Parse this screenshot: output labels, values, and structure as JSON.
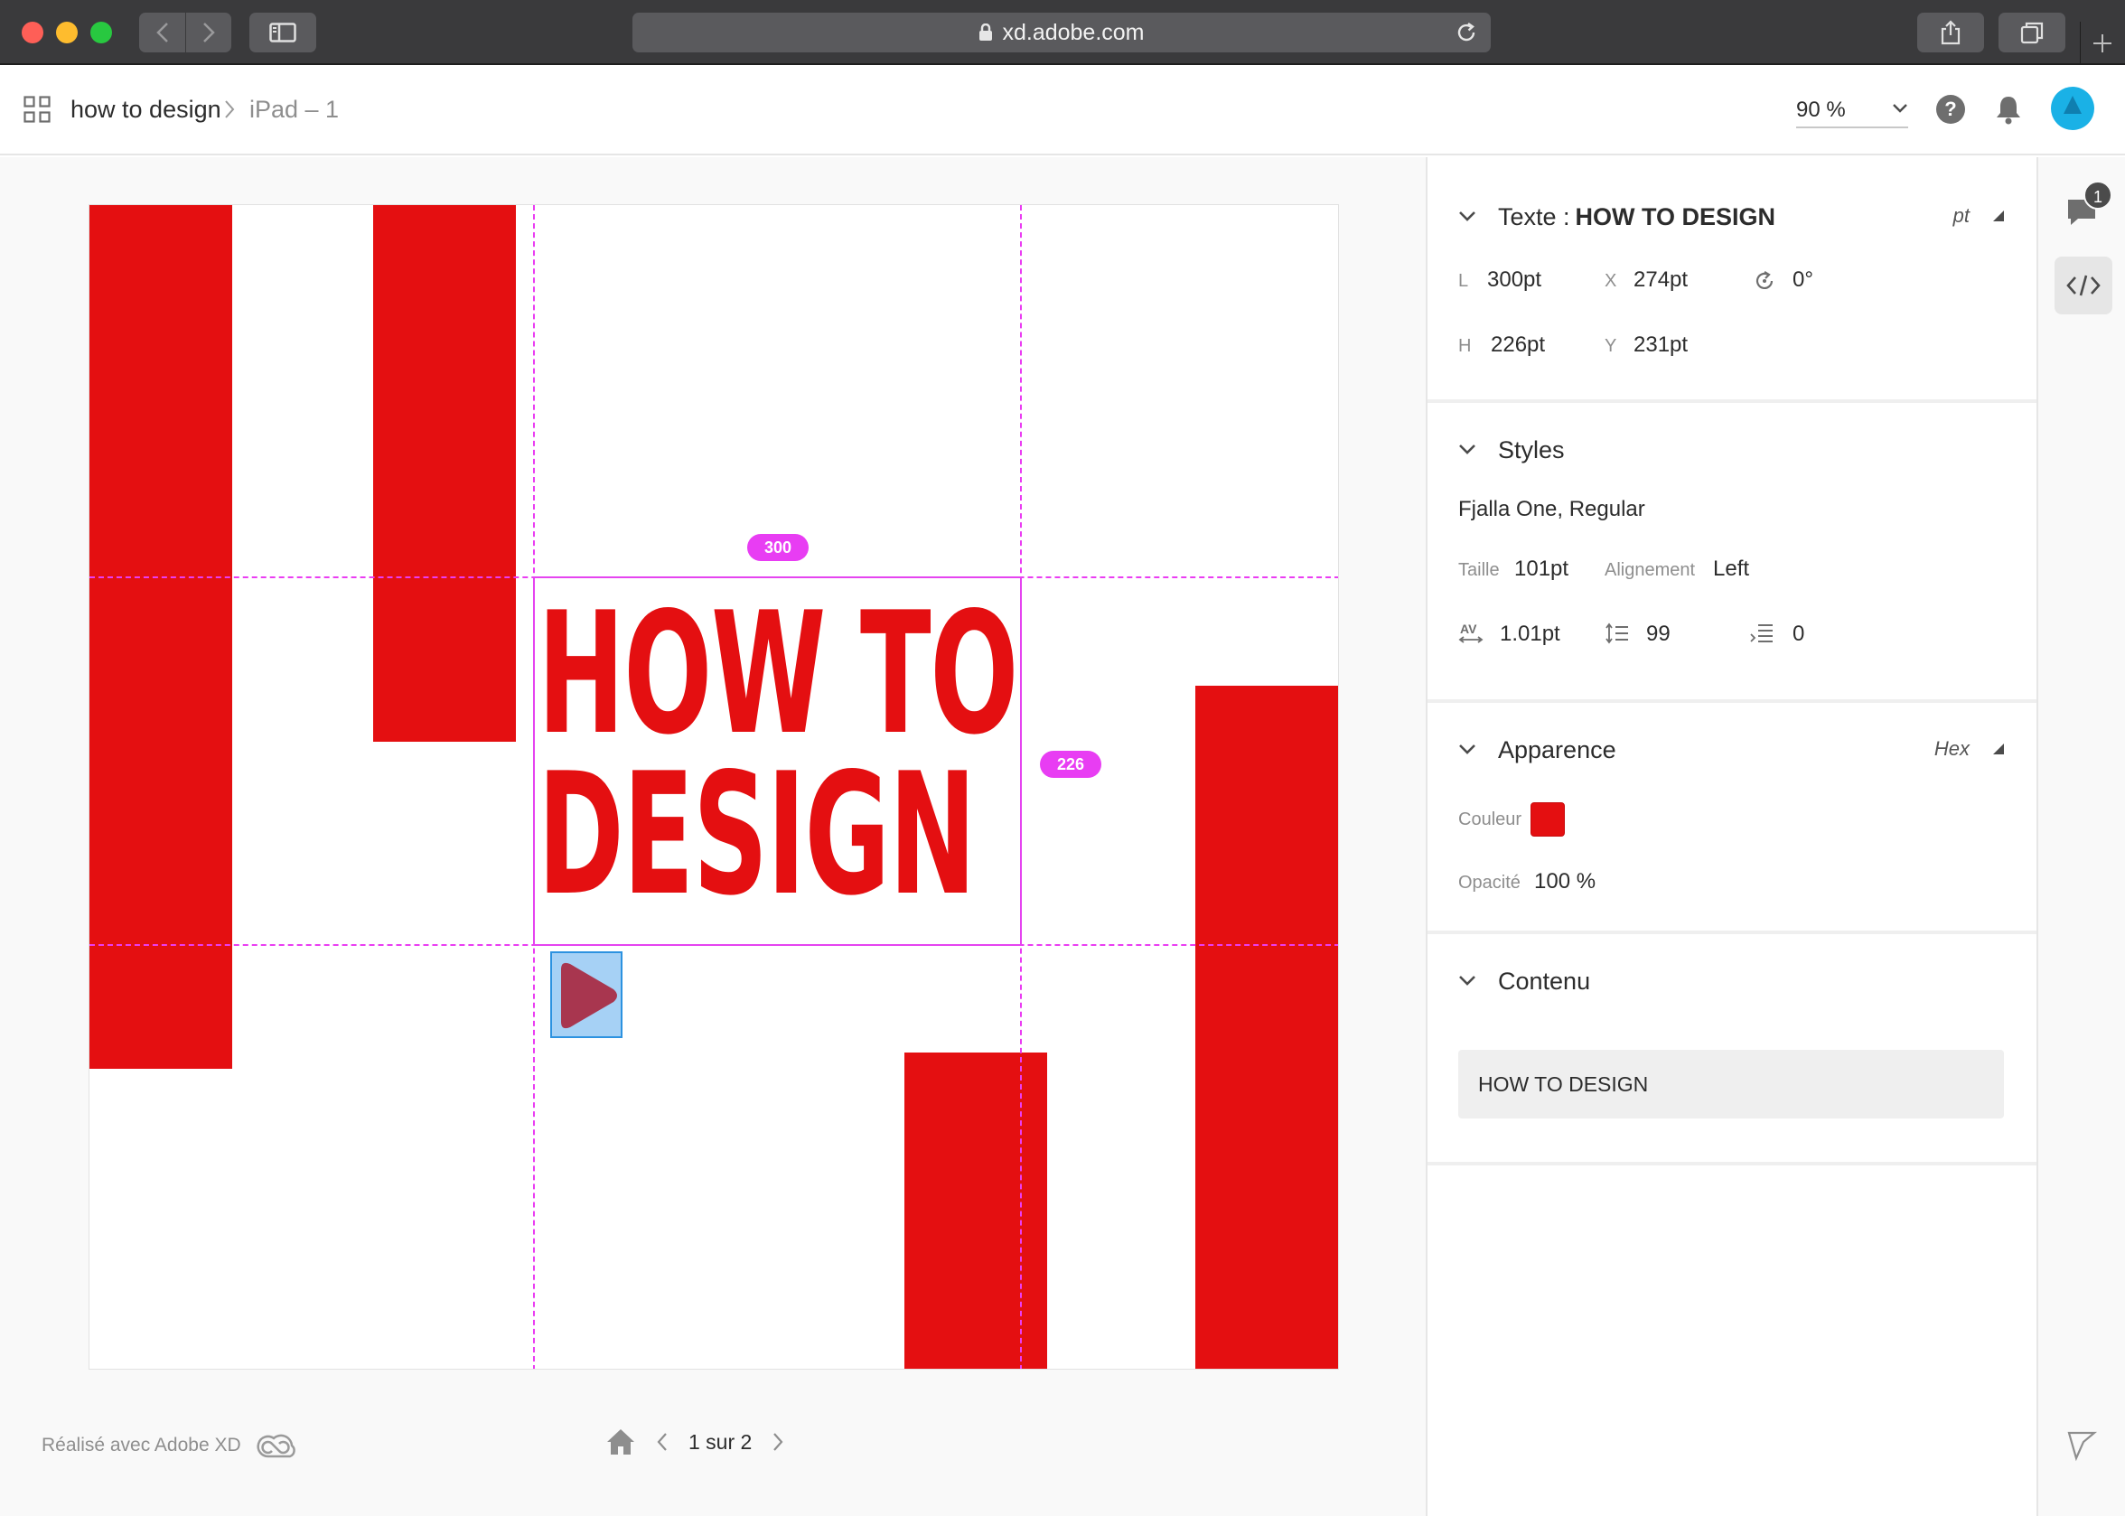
{
  "browser": {
    "url": "xd.adobe.com"
  },
  "header": {
    "project": "how to design",
    "page": "iPad – 1",
    "zoom": "90 %"
  },
  "canvas": {
    "title_line1": "HOW TO",
    "title_line2": "DESIGN",
    "width_badge": "300",
    "height_badge": "226",
    "accent_color": "#e40f11",
    "guide_color": "#ea3df2"
  },
  "footer": {
    "made_with": "Réalisé avec Adobe XD",
    "page_indicator": "1 sur 2"
  },
  "inspector": {
    "text_section": {
      "label": "Texte :",
      "name": "HOW TO DESIGN",
      "unit": "pt",
      "w_label": "L",
      "w_value": "300pt",
      "x_label": "X",
      "x_value": "274pt",
      "rotation": "0°",
      "h_label": "H",
      "h_value": "226pt",
      "y_label": "Y",
      "y_value": "231pt"
    },
    "styles": {
      "title": "Styles",
      "font": "Fjalla One, Regular",
      "size_label": "Taille",
      "size_value": "101pt",
      "align_label": "Alignement",
      "align_value": "Left",
      "char_spacing": "1.01pt",
      "line_spacing": "99",
      "para_spacing": "0"
    },
    "appearance": {
      "title": "Apparence",
      "mode": "Hex",
      "color_label": "Couleur",
      "color_value": "#e40f11",
      "opacity_label": "Opacité",
      "opacity_value": "100 %"
    },
    "content": {
      "title": "Contenu",
      "text": "HOW TO DESIGN"
    }
  },
  "rail": {
    "comment_count": "1"
  }
}
